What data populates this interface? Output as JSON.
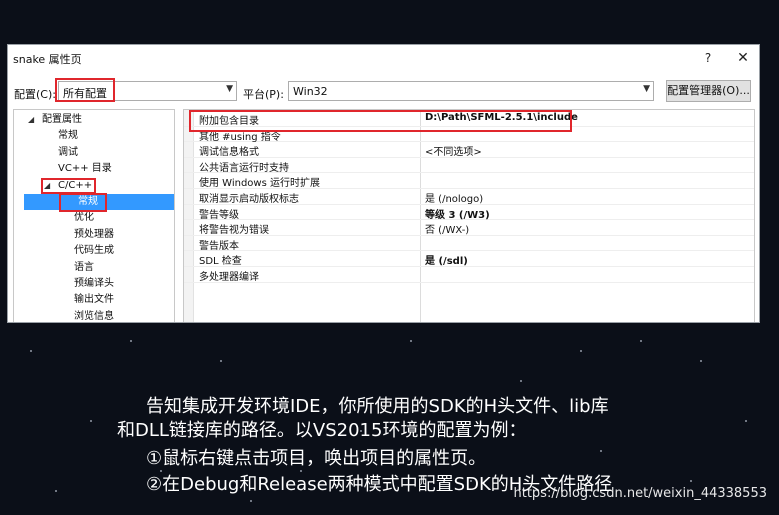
{
  "window": {
    "title": "snake 属性页",
    "help_label": "?",
    "close_label": "✕"
  },
  "config_bar": {
    "config_label": "配置(C):",
    "config_value": "所有配置",
    "platform_label": "平台(P):",
    "platform_value": "Win32",
    "manager_button": "配置管理器(O)..."
  },
  "tree": {
    "items": [
      {
        "label": "配置属性",
        "level": 0,
        "arrow": "◢"
      },
      {
        "label": "常规",
        "level": 1
      },
      {
        "label": "调试",
        "level": 1
      },
      {
        "label": "VC++ 目录",
        "level": 1
      },
      {
        "label": "C/C++",
        "level": 1,
        "arrow": "◢"
      },
      {
        "label": "常规",
        "level": 2,
        "selected": true
      },
      {
        "label": "优化",
        "level": 2
      },
      {
        "label": "预处理器",
        "level": 2
      },
      {
        "label": "代码生成",
        "level": 2
      },
      {
        "label": "语言",
        "level": 2
      },
      {
        "label": "预编译头",
        "level": 2
      },
      {
        "label": "输出文件",
        "level": 2
      },
      {
        "label": "浏览信息",
        "level": 2
      }
    ]
  },
  "properties": [
    {
      "name": "附加包含目录",
      "value": "D:\\Path\\SFML-2.5.1\\include",
      "bold": true
    },
    {
      "name": "其他 #using 指令",
      "value": ""
    },
    {
      "name": "调试信息格式",
      "value": "<不同选项>"
    },
    {
      "name": "公共语言运行时支持",
      "value": ""
    },
    {
      "name": "使用 Windows 运行时扩展",
      "value": ""
    },
    {
      "name": "取消显示启动版权标志",
      "value": "是 (/nologo)"
    },
    {
      "name": "警告等级",
      "value": "等级 3 (/W3)",
      "bold": true
    },
    {
      "name": "将警告视为错误",
      "value": "否 (/WX-)"
    },
    {
      "name": "警告版本",
      "value": ""
    },
    {
      "name": "SDL 检查",
      "value": "是 (/sdl)",
      "bold": true
    },
    {
      "name": "多处理器编译",
      "value": ""
    }
  ],
  "caption": {
    "lines": [
      "告知集成开发环境IDE，你所使用的SDK的H头文件、lib库",
      "和DLL链接库的路径。以VS2015环境的配置为例：",
      "①鼠标右键点击项目，唤出项目的属性页。",
      "②在Debug和Release两种模式中配置SDK的H头文件路径"
    ]
  },
  "watermark": "https://blog.csdn.net/weixin_44338553",
  "colors": {
    "highlight_red": "#e0262c",
    "selection_blue": "#3399ff",
    "background": "#0b0f18"
  }
}
